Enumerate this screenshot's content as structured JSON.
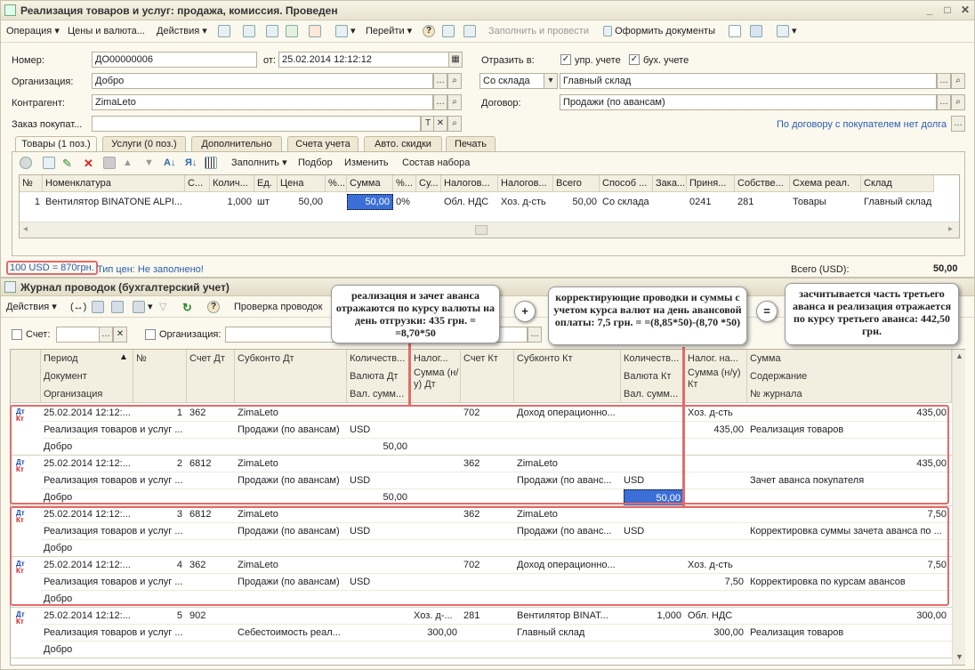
{
  "doc_window": {
    "title": "Реализация товаров и услуг: продажа, комиссия. Проведен",
    "toolbar": {
      "operation": "Операция",
      "prices": "Цены и валюта...",
      "actions": "Действия",
      "goto": "Перейти",
      "fill_post": "Заполнить и провести",
      "make_docs": "Оформить документы"
    },
    "fields": {
      "number_label": "Номер:",
      "number_value": "ДО00000006",
      "from_label": "от:",
      "date_value": "25.02.2014 12:12:12",
      "reflect_label": "Отразить в:",
      "mgmt_label": "упр. учете",
      "acc_label": "бух. учете",
      "org_label": "Организация:",
      "org_value": "Добро",
      "warehouse_type": "Со склада",
      "warehouse_value": "Главный склад",
      "contractor_label": "Контрагент:",
      "contractor_value": "ZimaLeto",
      "contract_label": "Договор:",
      "contract_value": "Продажи (по авансам)",
      "order_label": "Заказ покупат...",
      "debt_link": "По договору с покупателем нет долга"
    },
    "tabs": [
      "Товары (1 поз.)",
      "Услуги (0 поз.)",
      "Дополнительно",
      "Счета учета",
      "Авто. скидки",
      "Печать"
    ],
    "grid_toolbar": {
      "fill": "Заполнить",
      "pick": "Подбор",
      "change": "Изменить",
      "kit": "Состав набора"
    },
    "columns": [
      "№",
      "Номенклатура",
      "С...",
      "Колич...",
      "Ед.",
      "Цена",
      "%...",
      "Сумма",
      "%...",
      "Су...",
      "Налогов...",
      "Налогов...",
      "Всего",
      "Способ ...",
      "Зака...",
      "Приня...",
      "Собстве...",
      "Схема реал.",
      "Склад"
    ],
    "row": [
      "1",
      "Вентилятор BINATONE ALPI...",
      "",
      "1,000",
      "шт",
      "50,00",
      "",
      "50,00",
      "0%",
      "",
      "Обл. НДС",
      "Хоз. д-сть",
      "50,00",
      "Со склада",
      "",
      "0241",
      "281",
      "Товары",
      "Главный склад"
    ],
    "footer_rate": "100 USD = 870грн.",
    "footer_price": "Тип цен: Не заполнено!",
    "total_label": "Всего (USD):",
    "total_value": "50,00"
  },
  "journal": {
    "title": "Журнал проводок (бухгалтерский учет)",
    "actions": "Действия",
    "check": "Проверка проводок",
    "filter_account": "Счет:",
    "filter_org": "Организация:",
    "headers": {
      "period": "Период",
      "n": "№",
      "document": "Документ",
      "organization": "Организация",
      "acc_dt": "Счет Дт",
      "sub_dt": "Субконто Дт",
      "qty_dt": "Количеств...",
      "cur_dt": "Валюта Дт",
      "cursum_dt": "Вал. сумм...",
      "tax_dt": "Налог...",
      "sum_nu_dt": "Сумма (н/у) Дт",
      "acc_kt": "Счет Кт",
      "sub_kt": "Субконто Кт",
      "qty_kt": "Количеств...",
      "cur_kt": "Валюта Кт",
      "cursum_kt": "Вал. сумм...",
      "tax_kt": "Налог. на...",
      "sum_nu_kt": "Сумма (н/у) Кт",
      "sum": "Сумма",
      "content": "Содержание",
      "journal_no": "№ журнала"
    },
    "rows": [
      {
        "period": "25.02.2014 12:12:...",
        "n": "1",
        "doc": "Реализация товаров и услуг ...",
        "org": "Добро",
        "acc_dt": "362",
        "sub_dt1": "ZimaLeto",
        "sub_dt2": "Продажи (по авансам)",
        "qty_dt": "",
        "cur_dt": "USD",
        "cursum_dt": "50,00",
        "tax_dt": "",
        "snu_dt": "",
        "acc_kt": "702",
        "sub_kt1": "Доход операционно...",
        "sub_kt2": "",
        "qty_kt": "",
        "cur_kt": "",
        "cursum_kt": "",
        "tax_kt": "Хоз. д-сть",
        "snu_kt": "435,00",
        "sum": "435,00",
        "content": "Реализация товаров"
      },
      {
        "period": "25.02.2014 12:12:...",
        "n": "2",
        "doc": "Реализация товаров и услуг ...",
        "org": "Добро",
        "acc_dt": "6812",
        "sub_dt1": "ZimaLeto",
        "sub_dt2": "Продажи (по авансам)",
        "qty_dt": "",
        "cur_dt": "USD",
        "cursum_dt": "50,00",
        "tax_dt": "",
        "snu_dt": "",
        "acc_kt": "362",
        "sub_kt1": "ZimaLeto",
        "sub_kt2": "Продажи (по аванс...",
        "qty_kt": "",
        "cur_kt": "USD",
        "cursum_kt": "50,00",
        "tax_kt": "",
        "snu_kt": "",
        "sum": "435,00",
        "content": "Зачет аванса покупателя"
      },
      {
        "period": "25.02.2014 12:12:...",
        "n": "3",
        "doc": "Реализация товаров и услуг ...",
        "org": "Добро",
        "acc_dt": "6812",
        "sub_dt1": "ZimaLeto",
        "sub_dt2": "Продажи (по авансам)",
        "qty_dt": "",
        "cur_dt": "USD",
        "cursum_dt": "",
        "tax_dt": "",
        "snu_dt": "",
        "acc_kt": "362",
        "sub_kt1": "ZimaLeto",
        "sub_kt2": "Продажи (по аванс...",
        "qty_kt": "",
        "cur_kt": "USD",
        "cursum_kt": "",
        "tax_kt": "",
        "snu_kt": "",
        "sum": "7,50",
        "content": "Корректировка суммы зачета аванса по ..."
      },
      {
        "period": "25.02.2014 12:12:...",
        "n": "4",
        "doc": "Реализация товаров и услуг ...",
        "org": "Добро",
        "acc_dt": "362",
        "sub_dt1": "ZimaLeto",
        "sub_dt2": "Продажи (по авансам)",
        "qty_dt": "",
        "cur_dt": "USD",
        "cursum_dt": "",
        "tax_dt": "",
        "snu_dt": "",
        "acc_kt": "702",
        "sub_kt1": "Доход операционно...",
        "sub_kt2": "",
        "qty_kt": "",
        "cur_kt": "",
        "cursum_kt": "",
        "tax_kt": "Хоз. д-сть",
        "snu_kt": "7,50",
        "sum": "7,50",
        "content": "Корректировка по курсам авансов"
      },
      {
        "period": "25.02.2014 12:12:...",
        "n": "5",
        "doc": "Реализация товаров и услуг ...",
        "org": "Добро",
        "acc_dt": "902",
        "sub_dt1": "",
        "sub_dt2": "Себестоимость реал...",
        "qty_dt": "",
        "cur_dt": "",
        "cursum_dt": "",
        "tax_dt": "Хоз. д-...",
        "snu_dt": "300,00",
        "acc_kt": "281",
        "sub_kt1": "Вентилятор BINAT...",
        "sub_kt2": "Главный склад",
        "qty_kt": "1,000",
        "cur_kt": "",
        "cursum_kt": "",
        "tax_kt": "Обл. НДС",
        "snu_kt": "300,00",
        "sum": "300,00",
        "content": "Реализация товаров"
      }
    ]
  },
  "callouts": {
    "c1": "реализация и зачет аванса отражаются по курсу валюты на день отгрузки: 435 грн. = =8,70*50",
    "c2": "корректирующие проводки и суммы с учетом курса валют на день авансовой оплаты: 7,5 грн. = =(8,85*50)-(8,70 *50)",
    "c3": "засчитывается часть третьего аванса и реализация отражается по курсу третьего аванса: 442,50 грн.",
    "plus": "+",
    "equals": "="
  }
}
